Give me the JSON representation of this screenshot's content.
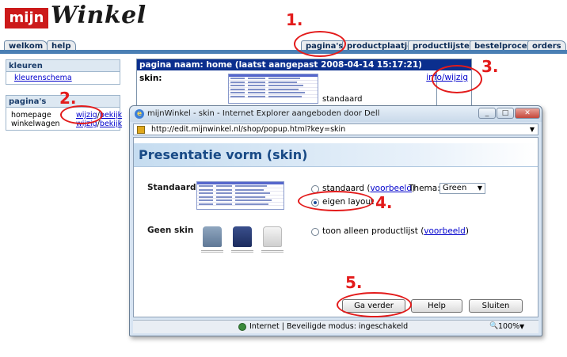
{
  "logo": {
    "box_text": "mijn",
    "word": "Winkel",
    "brand_red": "#cc1a1a"
  },
  "tabs": {
    "left": [
      "welkom",
      "help"
    ],
    "right": [
      "pagina's",
      "productplaatjes",
      "productlijsten",
      "bestelproces",
      "orders"
    ]
  },
  "sidebar": {
    "kleuren": {
      "title": "kleuren",
      "link": "kleurenschema"
    },
    "paginas": {
      "title": "pagina's",
      "rows": [
        {
          "name": "homepage",
          "edit": "wijzig",
          "sep": "/",
          "view": "bekijk"
        },
        {
          "name": "winkelwagen",
          "edit": "wijzig",
          "sep": "/",
          "view": "bekijk"
        }
      ]
    }
  },
  "main": {
    "header": "pagina naam: home (laatst aangepast  2008-04-14 15:17:21)",
    "skin_label": "skin:",
    "skin_value": "standaard",
    "info_link": "info/wijzig"
  },
  "popup": {
    "window_title": "mijnWinkel - skin - Internet Explorer aangeboden door Dell",
    "address": "http://edit.mijnwinkel.nl/shop/popup.html?key=skin",
    "heading": "Presentatie vorm (skin)",
    "standaard_label": "Standaard",
    "option_standaard": "standaard (",
    "option_standaard_link": "voorbeeld",
    "option_standaard_end": ")",
    "thema_label": "Thema:",
    "thema_value": "Green",
    "option_eigen": "eigen layout",
    "geen_skin_label": "Geen skin",
    "option_productlijst": "toon alleen productlijst (",
    "option_productlijst_link": "voorbeeld",
    "option_productlijst_end": ")",
    "buttons": {
      "verder": "Ga verder",
      "help": "Help",
      "sluiten": "Sluiten"
    },
    "status_text": "Internet | Beveiligde modus: ingeschakeld",
    "zoom": "100%",
    "selected_option": "eigen layout"
  },
  "annotations": {
    "numbers": [
      "1.",
      "2.",
      "3.",
      "4.",
      "5."
    ],
    "color": "#e31b1b"
  }
}
